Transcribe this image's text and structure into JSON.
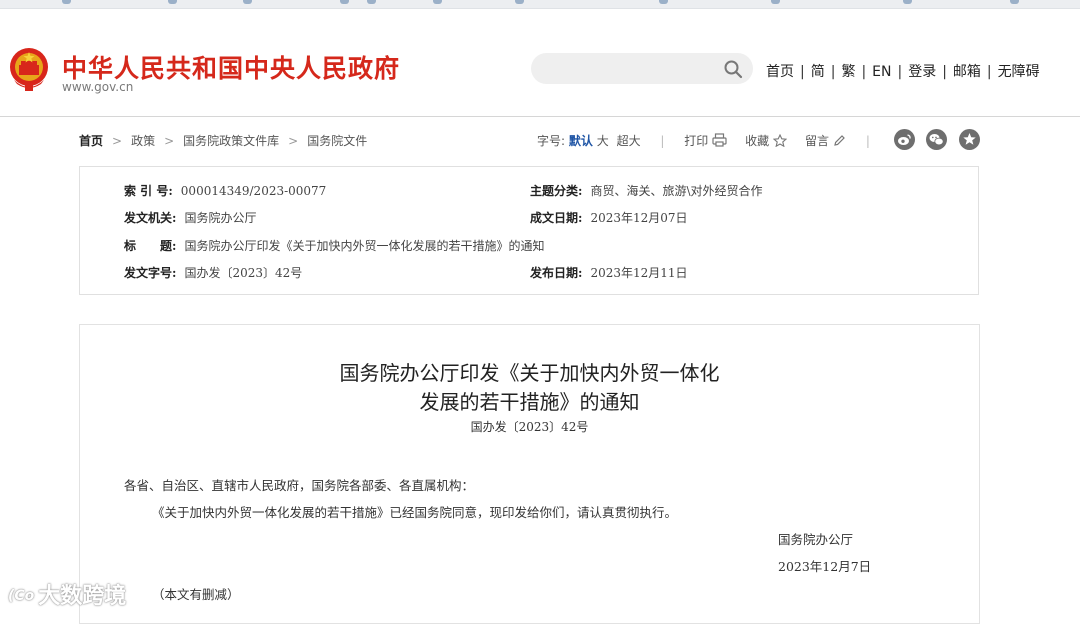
{
  "header": {
    "site_title": "中华人民共和国中央人民政府",
    "site_url": "www.gov.cn",
    "search_placeholder": "",
    "nav": [
      "首页",
      "简",
      "繁",
      "EN",
      "登录",
      "邮箱",
      "无障碍"
    ],
    "nav_separator": "|"
  },
  "breadcrumb": {
    "items": [
      "首页",
      "政策",
      "国务院政策文件库",
      "国务院文件"
    ],
    "arrow": ">"
  },
  "tools": {
    "font_size_label": "字号:",
    "font_sizes": [
      "默认",
      "大",
      "超大"
    ],
    "active_size": "默认",
    "print_label": "打印",
    "favorite_label": "收藏",
    "comment_label": "留言",
    "divider": "|",
    "share_icons": [
      "weibo-icon",
      "wechat-icon",
      "star-circle-icon"
    ]
  },
  "info": {
    "index_no_label": "索 引 号:",
    "index_no": "000014349/2023-00077",
    "category_label": "主题分类:",
    "category": "商贸、海关、旅游\\对外经贸合作",
    "issuer_label": "发文机关:",
    "issuer": "国务院办公厅",
    "written_date_label": "成文日期:",
    "written_date": "2023年12月07日",
    "title_label": "标　　题:",
    "title": "国务院办公厅印发《关于加快内外贸一体化发展的若干措施》的通知",
    "doc_no_label": "发文字号:",
    "doc_no": "国办发〔2023〕42号",
    "publish_date_label": "发布日期:",
    "publish_date": "2023年12月11日"
  },
  "document": {
    "title_line1": "国务院办公厅印发《关于加快内外贸一体化",
    "title_line2": "发展的若干措施》的通知",
    "doc_no": "国办发〔2023〕42号",
    "salutation": "各省、自治区、直辖市人民政府，国务院各部委、各直属机构：",
    "body": "《关于加快内外贸一体化发展的若干措施》已经国务院同意，现印发给你们，请认真贯彻执行。",
    "signature": "国务院办公厅",
    "date": "2023年12月7日",
    "note": "（本文有删减）"
  },
  "watermark": {
    "logo": "(Co",
    "text": "大数跨境"
  },
  "colors": {
    "brand_red": "#d5281b",
    "active_blue": "#1f55a5"
  }
}
